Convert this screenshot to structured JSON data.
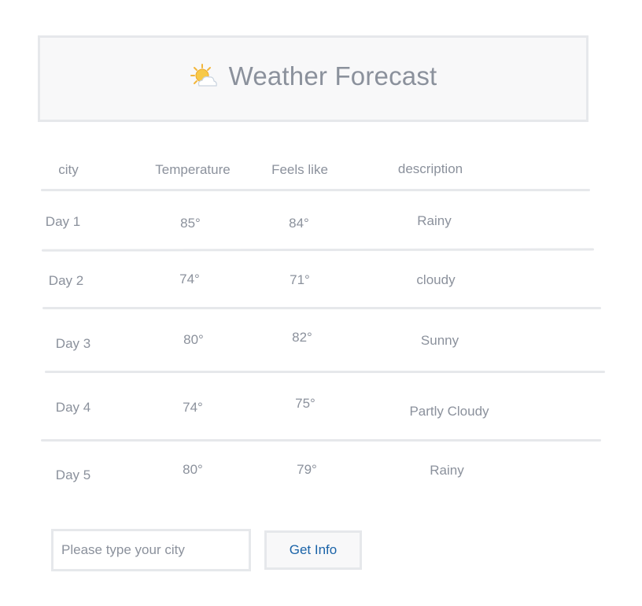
{
  "header": {
    "icon": "sun-behind-cloud-icon",
    "title": "Weather Forecast"
  },
  "table": {
    "columns": {
      "city": "city",
      "temperature": "Temperature",
      "feels_like": "Feels like",
      "description": "description"
    },
    "rows": [
      {
        "day": "Day 1",
        "temperature": "85°",
        "feels_like": "84°",
        "description": "Rainy"
      },
      {
        "day": "Day 2",
        "temperature": "74°",
        "feels_like": "71°",
        "description": "cloudy"
      },
      {
        "day": "Day 3",
        "temperature": "80°",
        "feels_like": "82°",
        "description": "Sunny"
      },
      {
        "day": "Day 4",
        "temperature": "74°",
        "feels_like": "75°",
        "description": "Partly Cloudy"
      },
      {
        "day": "Day 5",
        "temperature": "80°",
        "feels_like": "79°",
        "description": "Rainy"
      }
    ]
  },
  "search": {
    "placeholder": "Please type your city",
    "value": "",
    "button_label": "Get Info"
  },
  "colors": {
    "text": "#8b919c",
    "border": "#e6e8eb",
    "header_bg": "#f8f8f9",
    "button_text": "#1a63a8"
  }
}
